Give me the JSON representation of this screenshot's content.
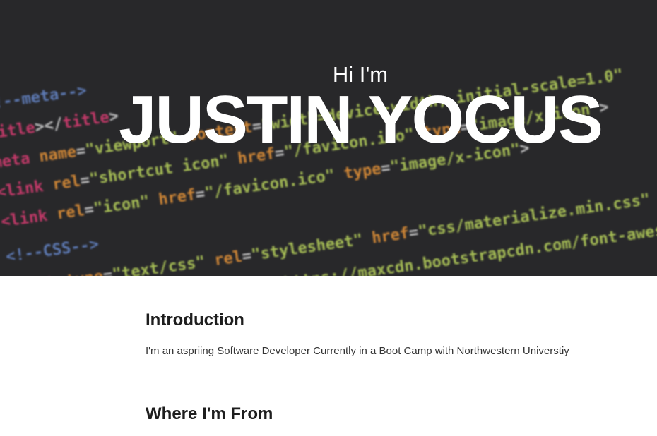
{
  "hero": {
    "greeting": "Hi I'm",
    "name": "JUSTIN YOCUS"
  },
  "sections": [
    {
      "title": "Introduction",
      "text": "I'm an aspriing Software Developer Currently in a Boot Camp with Northwestern Universtiy"
    },
    {
      "title": "Where I'm From"
    }
  ],
  "colors": {
    "hero_background": "#2b2b2e",
    "tag": "#e8407a",
    "attribute": "#f59d3c",
    "string": "#c4e062",
    "comment": "#6c8fd6",
    "plain": "#e8e8e8"
  }
}
